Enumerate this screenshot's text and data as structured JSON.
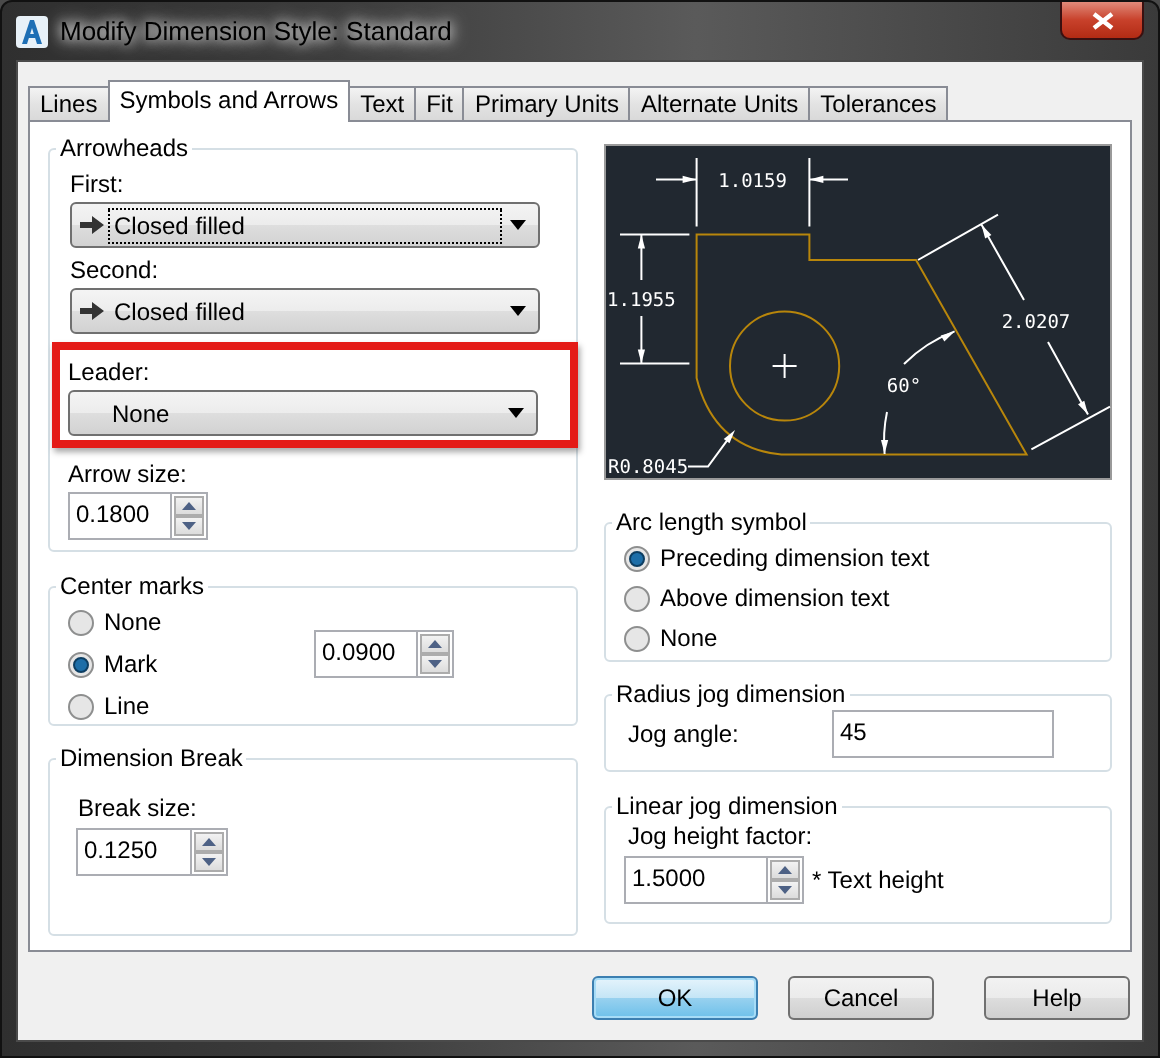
{
  "window": {
    "title": "Modify Dimension Style: Standard"
  },
  "tabs": [
    {
      "label": "Lines",
      "selected": false
    },
    {
      "label": "Symbols and Arrows",
      "selected": true
    },
    {
      "label": "Text",
      "selected": false
    },
    {
      "label": "Fit",
      "selected": false
    },
    {
      "label": "Primary Units",
      "selected": false
    },
    {
      "label": "Alternate Units",
      "selected": false
    },
    {
      "label": "Tolerances",
      "selected": false
    }
  ],
  "arrowheads": {
    "title": "Arrowheads",
    "first": {
      "label": "First:",
      "value": "Closed filled",
      "arrow_icon": true,
      "focused": true,
      "highlighted": false
    },
    "second": {
      "label": "Second:",
      "value": "Closed filled",
      "arrow_icon": true,
      "focused": false,
      "highlighted": false
    },
    "leader": {
      "label": "Leader:",
      "value": "None",
      "arrow_icon": false,
      "focused": false,
      "highlighted": true
    },
    "arrow_size": {
      "label": "Arrow size:",
      "value": "0.1800"
    }
  },
  "center_marks": {
    "title": "Center marks",
    "options": [
      {
        "label": "None",
        "selected": false
      },
      {
        "label": "Mark",
        "selected": true
      },
      {
        "label": "Line",
        "selected": false
      }
    ],
    "size": "0.0900"
  },
  "dimension_break": {
    "title": "Dimension Break",
    "break_size": {
      "label": "Break size:",
      "value": "0.1250"
    }
  },
  "preview": {
    "labels": [
      {
        "kind": "width",
        "text": "1.0159"
      },
      {
        "kind": "height",
        "text": "1.1955"
      },
      {
        "kind": "slant",
        "text": "2.0207"
      },
      {
        "kind": "angle",
        "text": "60°"
      },
      {
        "kind": "radius",
        "text": "R0.8045"
      }
    ]
  },
  "arc_length_symbol": {
    "title": "Arc length symbol",
    "options": [
      {
        "label": "Preceding dimension text",
        "selected": true
      },
      {
        "label": "Above dimension text",
        "selected": false
      },
      {
        "label": "None",
        "selected": false
      }
    ]
  },
  "radius_jog": {
    "title": "Radius jog dimension",
    "jog_angle": {
      "label": "Jog angle:",
      "value": "45"
    }
  },
  "linear_jog": {
    "title": "Linear jog dimension",
    "height_factor": {
      "label": "Jog height factor:",
      "value": "1.5000",
      "suffix": "* Text height"
    }
  },
  "buttons": [
    {
      "label": "OK",
      "default": true
    },
    {
      "label": "Cancel",
      "default": false
    },
    {
      "label": "Help",
      "default": false
    }
  ]
}
